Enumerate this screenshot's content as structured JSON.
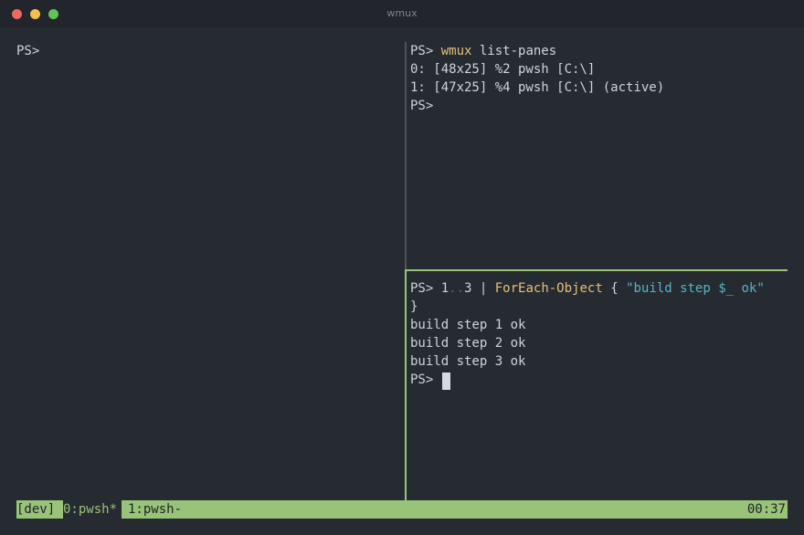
{
  "window": {
    "title": "wmux",
    "colors": {
      "close": "#ed6a5e",
      "minimize": "#f4bf4f",
      "maximize": "#61c554"
    }
  },
  "pane_left": {
    "prompt": "PS>"
  },
  "pane_top_right": {
    "cmd_prompt": "PS> ",
    "cmd_name": "wmux",
    "cmd_args": " list-panes",
    "out1": "0: [48x25] %2 pwsh [C:\\]",
    "out2": "1: [47x25] %4 pwsh [C:\\] (active)",
    "prompt": "PS>"
  },
  "pane_bottom_right": {
    "cmd_prompt": "PS> 1",
    "range_op": "..",
    "range_end": "3",
    "pipe": " | ",
    "cmdlet": "ForEach-Object",
    "brace_open": " { ",
    "string": "\"build step $_ ok\"",
    "brace_close": "}",
    "out1": "build step 1 ok",
    "out2": "build step 2 ok",
    "out3": "build step 3 ok",
    "prompt": "PS>"
  },
  "status_bar": {
    "session": "[dev]",
    "window_0": "0:pwsh*",
    "window_1": "1:pwsh-",
    "clock": "00:37",
    "accent": "#98c379"
  }
}
